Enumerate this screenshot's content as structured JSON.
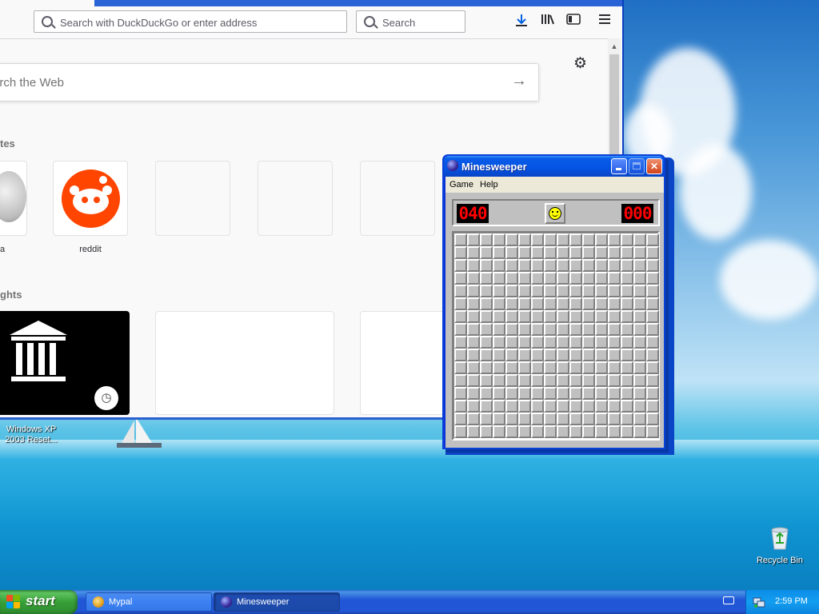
{
  "browser": {
    "url_placeholder": "Search with DuckDuckGo or enter address",
    "search_placeholder": "Search",
    "web_search_placeholder": "arch the Web",
    "sections": {
      "top_sites": "tes",
      "highlights": "ghts"
    },
    "top_sites": [
      {
        "label": "a"
      },
      {
        "label": "reddit"
      }
    ],
    "icons": {
      "download": "download-icon",
      "library": "library-icon",
      "sidebar": "sidebar-icon",
      "menu": "menu-icon",
      "settings": "gear-icon"
    }
  },
  "desktop": {
    "icons": [
      {
        "label": "Windows XP 2003 Reset..."
      },
      {
        "label": "Recycle Bin"
      }
    ]
  },
  "minesweeper": {
    "title": "Minesweeper",
    "menu": [
      "Game",
      "Help"
    ],
    "mines_remaining": "040",
    "timer": "000",
    "rows": 16,
    "cols": 16
  },
  "taskbar": {
    "start_label": "start",
    "tasks": [
      {
        "label": "Mypal",
        "active": false
      },
      {
        "label": "Minesweeper",
        "active": true
      }
    ],
    "clock": "2:59 PM"
  },
  "colors": {
    "xp_blue": "#0831d9",
    "start_green": "#37a037",
    "reddit": "#ff4500",
    "lcd_red": "#ff0000"
  }
}
